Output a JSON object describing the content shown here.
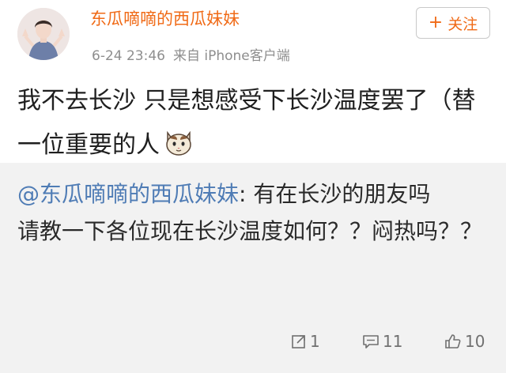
{
  "post": {
    "author": "东瓜嘀嘀的西瓜妹妹",
    "timestamp": "6-24 23:46",
    "source": "来自 iPhone客户端",
    "follow_label": "关注",
    "text": "我不去长沙 只是想感受下长沙温度罢了（替一位重要的人",
    "emoji": "cat-face-emoji"
  },
  "repost": {
    "mention": "@东瓜嘀嘀的西瓜妹妹",
    "text": ": 有在长沙的朋友吗\n请教一下各位现在长沙温度如何？？闷热吗？？",
    "actions": {
      "repost_count": "1",
      "comment_count": "11",
      "like_count": "10"
    }
  },
  "colors": {
    "author": "#f06a16",
    "mention": "#4f7cb5",
    "repost_background": "#f2f2f2"
  }
}
